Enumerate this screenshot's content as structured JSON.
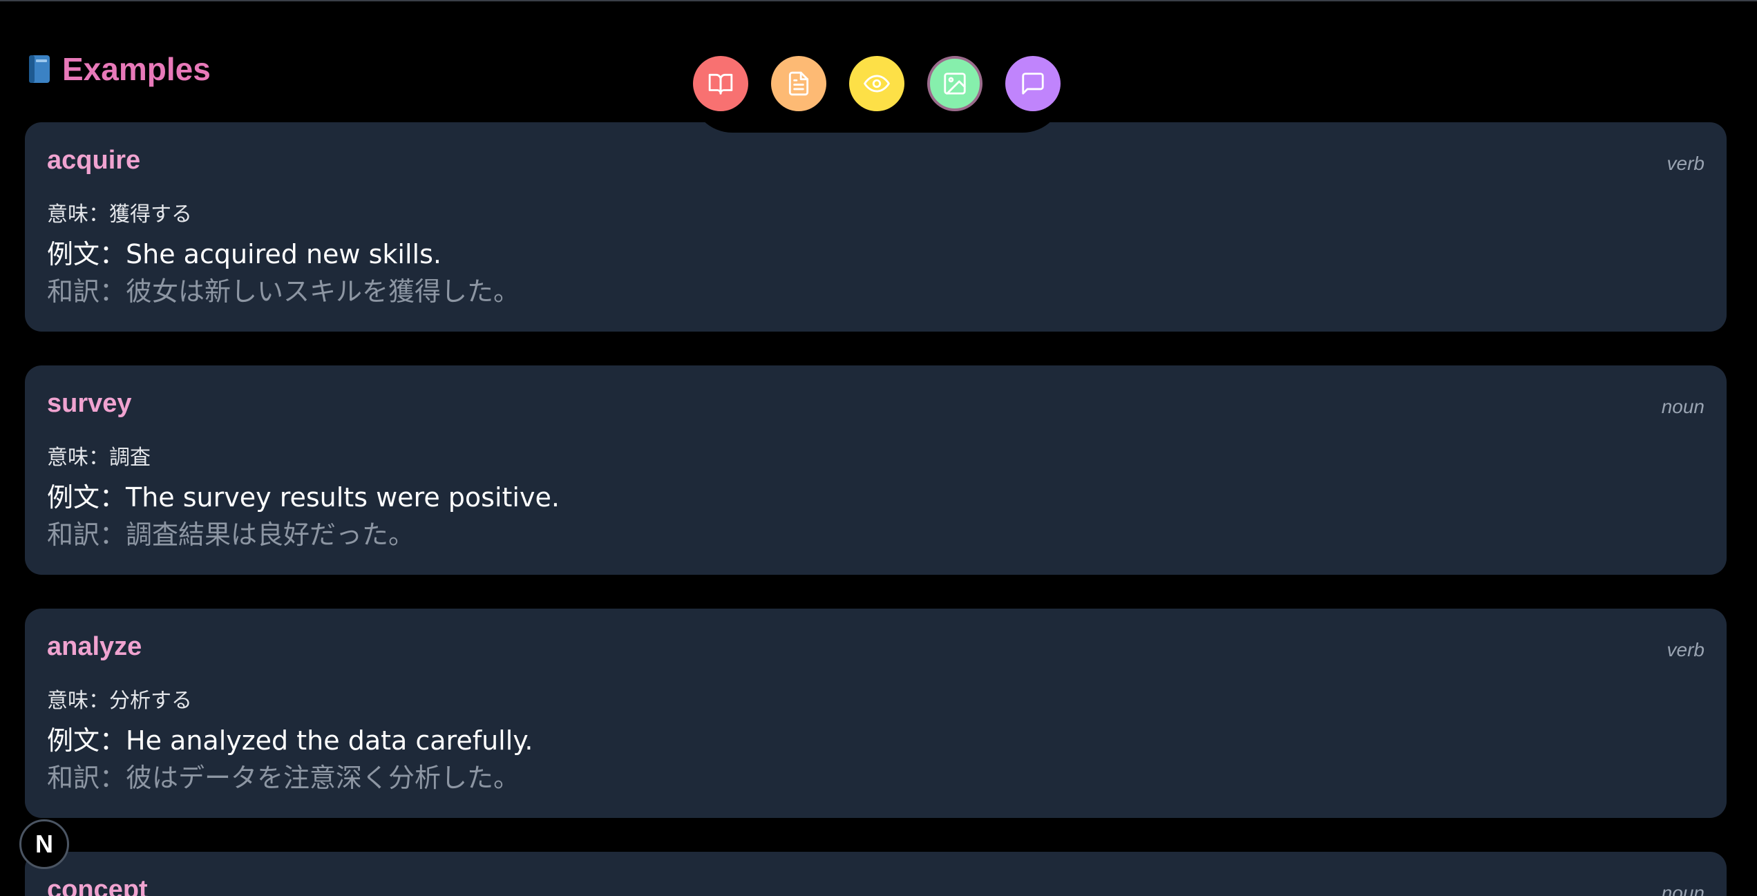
{
  "page": {
    "title": "Examples",
    "title_icon": "blue-book-icon"
  },
  "toolbar": {
    "buttons": [
      {
        "name": "book-open-icon",
        "color": "#f87171",
        "active": false
      },
      {
        "name": "document-icon",
        "color": "#fdba74",
        "active": false
      },
      {
        "name": "eye-icon",
        "color": "#fde047",
        "active": false
      },
      {
        "name": "image-icon",
        "color": "#86efac",
        "active": true
      },
      {
        "name": "chat-bubble-icon",
        "color": "#c084fc",
        "active": false
      }
    ]
  },
  "cards": [
    {
      "word": "acquire",
      "pos": "verb",
      "meaning": "意味：獲得する",
      "example": "例文：She acquired new skills.",
      "translation": "和訳：彼女は新しいスキルを獲得した。"
    },
    {
      "word": "survey",
      "pos": "noun",
      "meaning": "意味：調査",
      "example": "例文：The survey results were positive.",
      "translation": "和訳：調査結果は良好だった。"
    },
    {
      "word": "analyze",
      "pos": "verb",
      "meaning": "意味：分析する",
      "example": "例文：He analyzed the data carefully.",
      "translation": "和訳：彼はデータを注意深く分析した。"
    },
    {
      "word": "concept",
      "pos": "noun"
    }
  ],
  "badge": {
    "letter": "N"
  },
  "colors": {
    "background": "#000000",
    "card": "#1e2939",
    "title": "#e879b9",
    "word": "#f0a3d0",
    "muted": "#8d96a3"
  }
}
